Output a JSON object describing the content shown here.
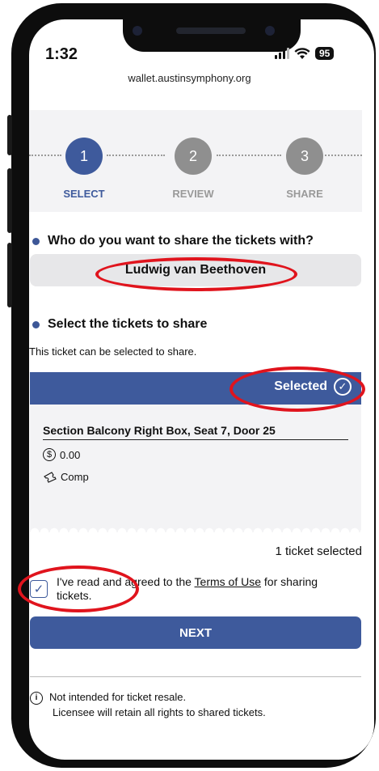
{
  "status": {
    "time": "1:32",
    "battery": "95",
    "url": "wallet.austinsymphony.org"
  },
  "steps": [
    {
      "number": "1",
      "label": "SELECT",
      "active": true
    },
    {
      "number": "2",
      "label": "REVIEW",
      "active": false
    },
    {
      "number": "3",
      "label": "SHARE",
      "active": false
    }
  ],
  "recipient": {
    "question": "Who do you want to share the tickets with?",
    "name": "Ludwig van Beethoven"
  },
  "tickets": {
    "heading": "Select the tickets to share",
    "hint": "This ticket can be selected to share.",
    "selected_label": "Selected",
    "section": "Section Balcony Right Box, Seat 7, Door 25",
    "price": "0.00",
    "type": "Comp",
    "count_text": "1 ticket selected"
  },
  "agreement": {
    "checked": true,
    "text_before": "I've read and agreed to the ",
    "link": "Terms of Use",
    "text_after": " for sharing tickets."
  },
  "next_label": "NEXT",
  "note": {
    "line1": "Not intended for ticket resale.",
    "line2": "Licensee will retain all rights to shared tickets."
  },
  "colors": {
    "accent": "#3e5a9c",
    "inactive_step": "#8f8f8f",
    "highlight": "#e0141d"
  }
}
